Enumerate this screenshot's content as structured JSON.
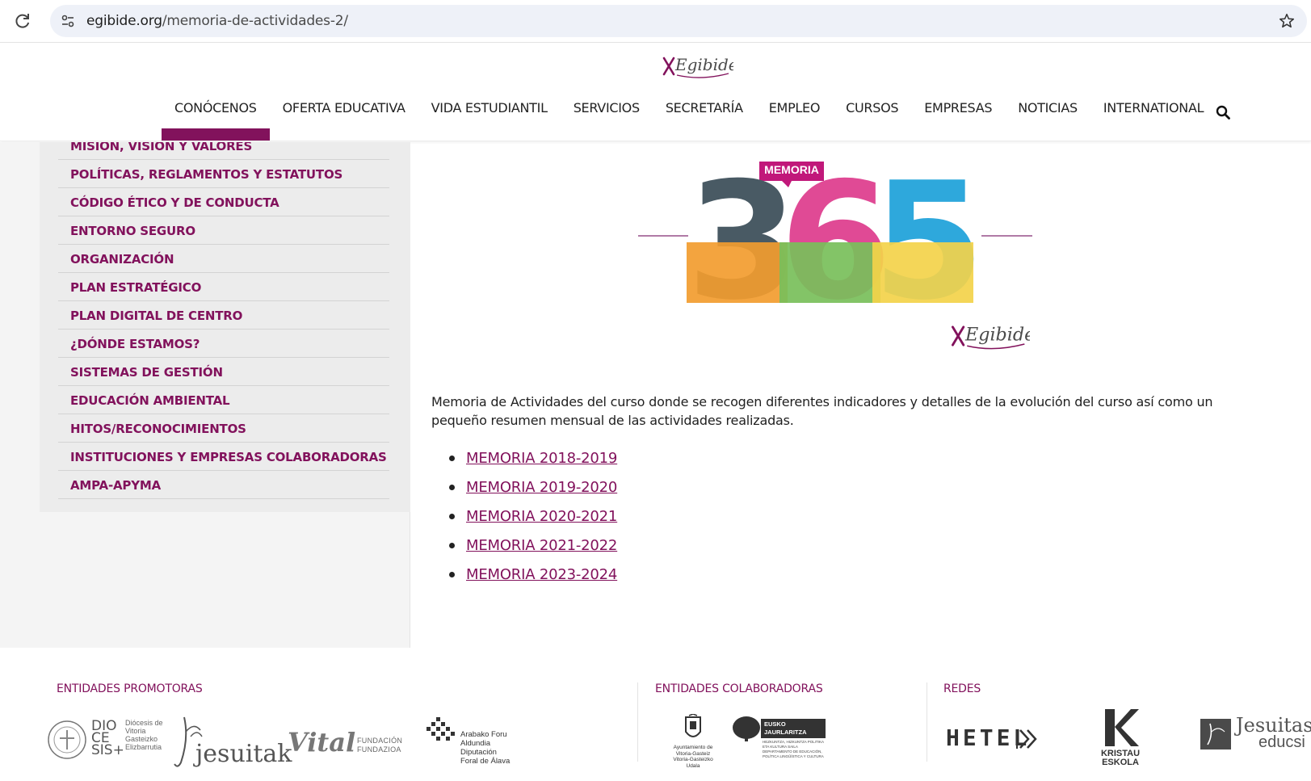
{
  "browser": {
    "url_domain": "egibide.org",
    "url_path": "/memoria-de-actividades-2/"
  },
  "header": {
    "logo_text": "Egibide",
    "nav": [
      {
        "label": "CONÓCENOS",
        "active": true
      },
      {
        "label": "OFERTA EDUCATIVA",
        "active": false
      },
      {
        "label": "VIDA ESTUDIANTIL",
        "active": false
      },
      {
        "label": "SERVICIOS",
        "active": false
      },
      {
        "label": "SECRETARÍA",
        "active": false
      },
      {
        "label": "EMPLEO",
        "active": false
      },
      {
        "label": "CURSOS",
        "active": false
      },
      {
        "label": "EMPRESAS",
        "active": false
      },
      {
        "label": "NOTICIAS",
        "active": false
      },
      {
        "label": "INTERNATIONAL",
        "active": false
      }
    ]
  },
  "sidebar": {
    "items": [
      "MISIÓN, VISIÓN Y VALORES",
      "POLÍTICAS, REGLAMENTOS Y ESTATUTOS",
      "CÓDIGO ÉTICO Y DE CONDUCTA",
      "ENTORNO SEGURO",
      "ORGANIZACIÓN",
      "PLAN ESTRATÉGICO",
      "PLAN DIGITAL DE CENTRO",
      "¿DÓNDE ESTAMOS?",
      "SISTEMAS DE GESTIÓN",
      "EDUCACIÓN AMBIENTAL",
      "HITOS/RECONOCIMIENTOS",
      "INSTITUCIONES Y EMPRESAS COLABORADORAS",
      "AMPA-APYMA"
    ]
  },
  "main": {
    "hero": {
      "badge": "MEMORIA",
      "number": "365",
      "logo_text": "Egibide"
    },
    "intro": "Memoria de Actividades del curso donde se recogen diferentes indicadores y detalles de la evolución del curso así como un pequeño resumen mensual de las actividades realizadas.",
    "links": [
      "MEMORIA 2018-2019",
      "MEMORIA 2019-2020",
      "MEMORIA 2020-2021",
      "MEMORIA 2021-2022",
      "MEMORIA 2023-2024"
    ]
  },
  "footer": {
    "promotoras_label": "ENTIDADES PROMOTORAS",
    "colaboradoras_label": "ENTIDADES COLABORADORAS",
    "redes_label": "REDES",
    "diocesis": {
      "big": "DIO CE SIS+",
      "small": "Diócesis de Vitoria Gasteizko Elizbarrutia"
    },
    "jesuitak": "jesuitak",
    "vital": {
      "big": "Vital",
      "small": "FUNDACIÓN FUNDAZIOA"
    },
    "araba": "Arabako Foru Aldundia Diputación Foral de Álava",
    "ayuntamiento": "Ayuntamiento de Vitoria-Gasteiz Vitoria-Gasteizko Udala",
    "eusko": {
      "line1": "EUSKO JAURLARITZA",
      "line2": "GOBIERNO VASCO",
      "sub1": "HEZKUNTZA, HIZKUNTZA POLITIKA ETA KULTURA SAILA",
      "sub2": "DEPARTAMENTO DE EDUCACIÓN, POLÍTICA LINGÜÍSTICA Y CULTURA"
    },
    "hetel": "HETEL",
    "kristau": "KRISTAU ESKOLA",
    "educsi": {
      "line1": "Jesuitas",
      "line2": "educsi"
    }
  },
  "colors": {
    "accent": "#82125c",
    "sidebar_bg": "#ececec"
  }
}
